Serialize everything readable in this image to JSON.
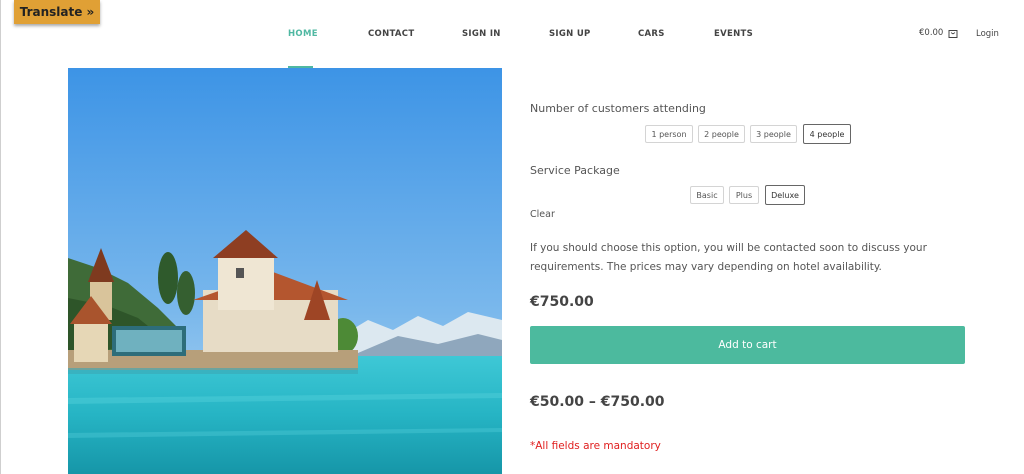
{
  "translate": {
    "label": "Translate »"
  },
  "nav": {
    "items": [
      {
        "label": "HOME"
      },
      {
        "label": "CONTACT"
      },
      {
        "label": "SIGN IN"
      },
      {
        "label": "SIGN UP"
      },
      {
        "label": "CARS"
      },
      {
        "label": "EVENTS"
      }
    ],
    "active": "HOME",
    "cart_total": "€0.00",
    "login_label": "Login"
  },
  "product": {
    "customers_label": "Number of customers attending",
    "customer_options": [
      "1 person",
      "2 people",
      "3 people",
      "4 people"
    ],
    "customer_selected": "4 people",
    "package_label": "Service Package",
    "package_options": [
      "Basic",
      "Plus",
      "Deluxe"
    ],
    "package_selected": "Deluxe",
    "clear_label": "Clear",
    "description": "If you should choose this option, you will be contacted soon to discuss your requirements. The prices may vary depending on hotel availability.",
    "variant_price": "€750.00",
    "add_to_cart_label": "Add to cart",
    "price_range": "€50.00 – €750.00",
    "mandatory_note": "*All fields are mandatory"
  },
  "colors": {
    "accent": "#4cba9e",
    "translate_bg": "#e0a035",
    "error": "#e02020"
  }
}
